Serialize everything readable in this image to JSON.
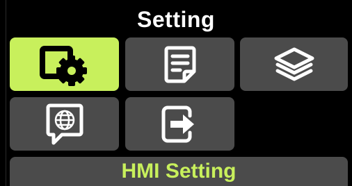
{
  "header": {
    "title": "Setting"
  },
  "menu": {
    "items": [
      {
        "id": "device-settings",
        "icon": "device-gear-icon",
        "active": true
      },
      {
        "id": "document",
        "icon": "document-icon",
        "active": false
      },
      {
        "id": "layers",
        "icon": "layers-icon",
        "active": false
      },
      {
        "id": "network",
        "icon": "globe-chat-icon",
        "active": false
      },
      {
        "id": "exit",
        "icon": "exit-icon",
        "active": false
      }
    ]
  },
  "status": {
    "label": "HMI Setting"
  },
  "colors": {
    "accent": "#c8f05c",
    "tile": "#4b4b4b",
    "background": "#000000"
  }
}
